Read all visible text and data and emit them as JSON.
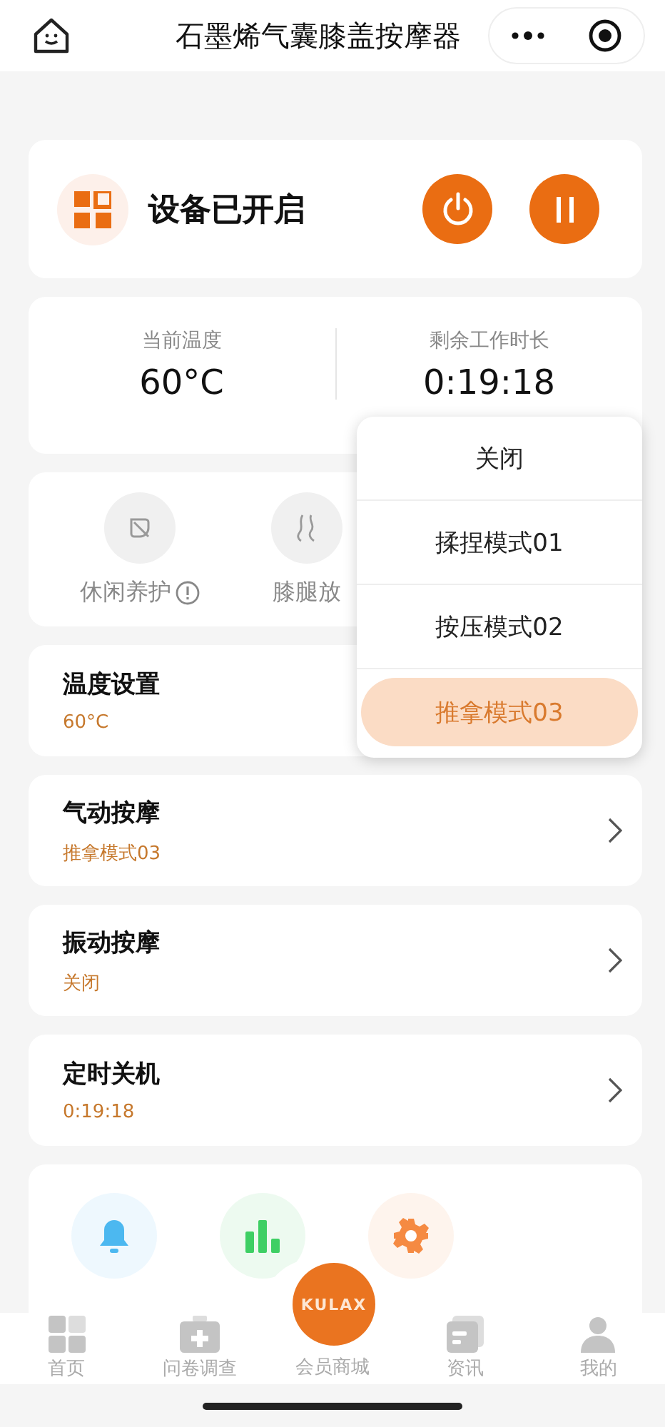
{
  "nav": {
    "title": "石墨烯气囊膝盖按摩器"
  },
  "device": {
    "status": "设备已开启"
  },
  "stats": [
    {
      "label": "当前温度",
      "value": "60°C"
    },
    {
      "label": "剩余工作时长",
      "value": "0:19:18"
    }
  ],
  "features": [
    {
      "label": "休闲养护",
      "info": true
    },
    {
      "label": "膝腿放",
      "info": false
    }
  ],
  "settings": [
    {
      "title": "温度设置",
      "value": "60°C",
      "chevron": false
    },
    {
      "title": "气动按摩",
      "value": "推拿模式03",
      "chevron": true
    },
    {
      "title": "振动按摩",
      "value": "关闭",
      "chevron": true
    },
    {
      "title": "定时关机",
      "value": "0:19:18",
      "chevron": true
    }
  ],
  "popup": {
    "options": [
      {
        "label": "关闭",
        "selected": false
      },
      {
        "label": "揉捏模式01",
        "selected": false
      },
      {
        "label": "按压模式02",
        "selected": false
      },
      {
        "label": "推拿模式03",
        "selected": true
      }
    ]
  },
  "tools": [
    {
      "color": "#4cb8f0"
    },
    {
      "color": "#3ecf64"
    },
    {
      "color": "#f58a42"
    }
  ],
  "tabbar": [
    {
      "kind": "icon",
      "label": "首页"
    },
    {
      "kind": "icon",
      "label": "问卷调查"
    },
    {
      "kind": "logo",
      "logo": "KULAX",
      "label": "会员商城"
    },
    {
      "kind": "icon",
      "label": "资讯"
    },
    {
      "kind": "icon",
      "label": "我的"
    }
  ]
}
